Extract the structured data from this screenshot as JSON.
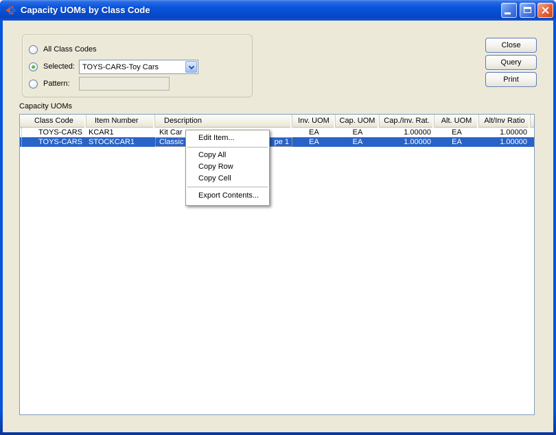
{
  "window": {
    "title": "Capacity UOMs by Class Code"
  },
  "filter": {
    "all_classes_label": "All Class Codes",
    "selected_label": "Selected:",
    "selected_value": "TOYS-CARS-Toy Cars",
    "pattern_label": "Pattern:",
    "pattern_value": ""
  },
  "actions": {
    "close": "Close",
    "query": "Query",
    "print": "Print"
  },
  "table": {
    "caption": "Capacity UOMs",
    "columns": [
      "Class Code",
      "Item Number",
      "Description",
      "Inv. UOM",
      "Cap. UOM",
      "Cap./Inv. Rat.",
      "Alt. UOM",
      "Alt/Inv Ratio"
    ],
    "rows": [
      {
        "class_code": "TOYS-CARS",
        "item_number": "KCAR1",
        "description": "Kit Car",
        "inv_uom": "EA",
        "cap_uom": "EA",
        "cap_inv_rat": "1.00000",
        "alt_uom": "EA",
        "alt_inv_ratio": "1.00000",
        "selected": false
      },
      {
        "class_code": "TOYS-CARS",
        "item_number": "STOCKCAR1",
        "description": "Classic",
        "description_tail": "pe 1",
        "inv_uom": "EA",
        "cap_uom": "EA",
        "cap_inv_rat": "1.00000",
        "alt_uom": "EA",
        "alt_inv_ratio": "1.00000",
        "selected": true
      }
    ]
  },
  "context_menu": {
    "items": [
      "Edit Item...",
      "Copy All",
      "Copy Row",
      "Copy Cell",
      "Export Contents..."
    ]
  },
  "icons": {
    "app_icon": "xtuple-x-logo",
    "combo_arrow": "chevron-down",
    "titlebar_buttons": [
      "minimize",
      "maximize",
      "close"
    ]
  },
  "colors": {
    "titlebar": "#0855DD",
    "background": "#ECE9D8",
    "selection": "#2A63C8",
    "close_button": "#D9512C",
    "radio_selected_dot": "#3BAA35",
    "grid_border": "#7F9DB9"
  }
}
